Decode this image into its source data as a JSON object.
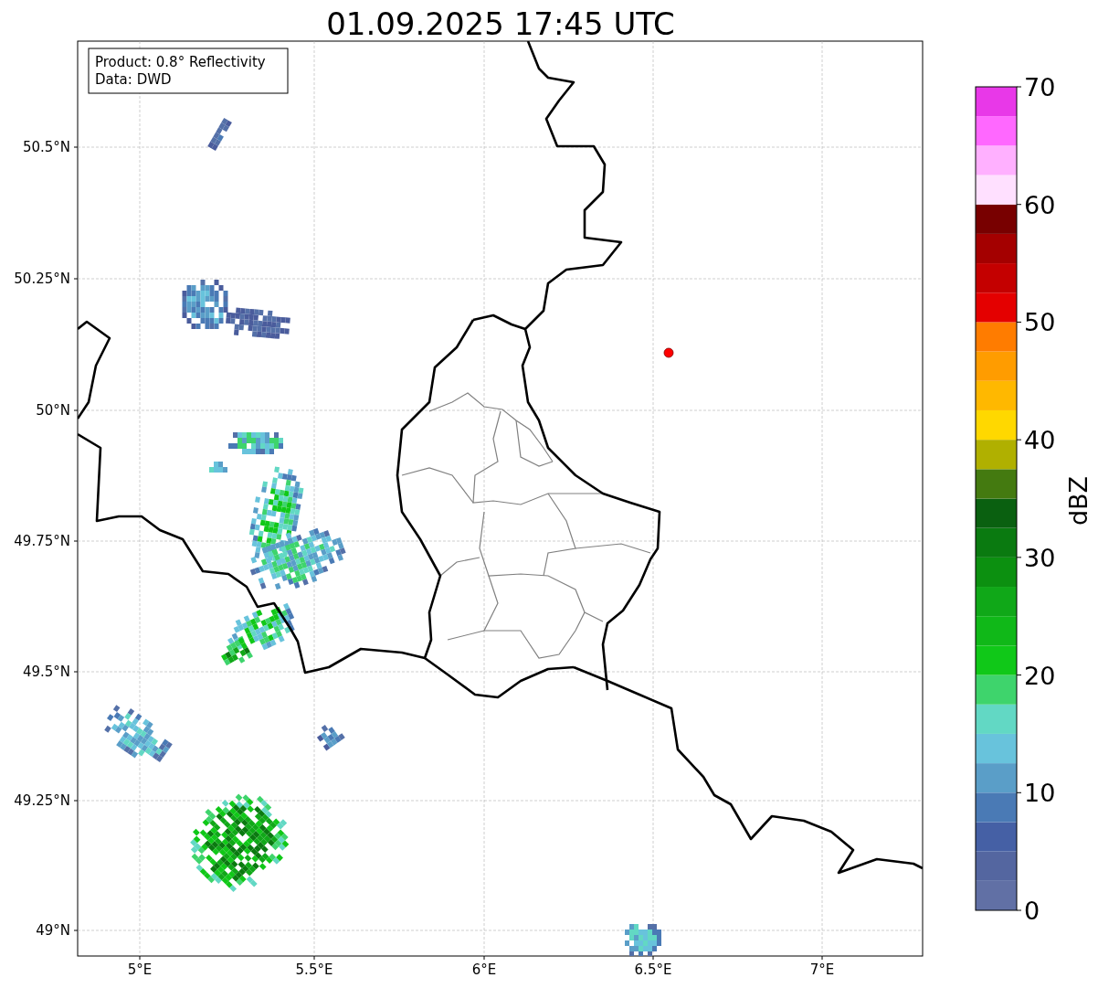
{
  "title": "01.09.2025 17:45 UTC",
  "info_box": {
    "lines": [
      "Product: 0.8° Reflectivity",
      "Data: DWD"
    ]
  },
  "y_ticks": [
    "50.5°N",
    "50.25°N",
    "50°N",
    "49.75°N",
    "49.5°N",
    "49.25°N",
    "49°N"
  ],
  "x_ticks": [
    "5°E",
    "5.5°E",
    "6°E",
    "6.5°E",
    "7°E"
  ],
  "colorbar": {
    "label": "dBZ",
    "ticks": [
      "70",
      "60",
      "50",
      "40",
      "30",
      "20",
      "10",
      "0"
    ],
    "segments": [
      {
        "color": "#6170a5"
      },
      {
        "color": "#5466a0"
      },
      {
        "color": "#4560a5"
      },
      {
        "color": "#4a7ab5"
      },
      {
        "color": "#5a9ec8"
      },
      {
        "color": "#68c3dc"
      },
      {
        "color": "#62d8c4"
      },
      {
        "color": "#3ed46c"
      },
      {
        "color": "#10c818"
      },
      {
        "color": "#10b818"
      },
      {
        "color": "#10a818"
      },
      {
        "color": "#0c9010"
      },
      {
        "color": "#0a7a10"
      },
      {
        "color": "#0a6010"
      },
      {
        "color": "#447a10"
      },
      {
        "color": "#b0b000"
      },
      {
        "color": "#ffd800"
      },
      {
        "color": "#ffb800"
      },
      {
        "color": "#ff9c00"
      },
      {
        "color": "#ff7c00"
      },
      {
        "color": "#e40000"
      },
      {
        "color": "#c40000"
      },
      {
        "color": "#a40000"
      },
      {
        "color": "#780000"
      },
      {
        "color": "#ffe0ff"
      },
      {
        "color": "#ffb0ff"
      },
      {
        "color": "#ff68ff"
      },
      {
        "color": "#e838e8"
      }
    ]
  }
}
